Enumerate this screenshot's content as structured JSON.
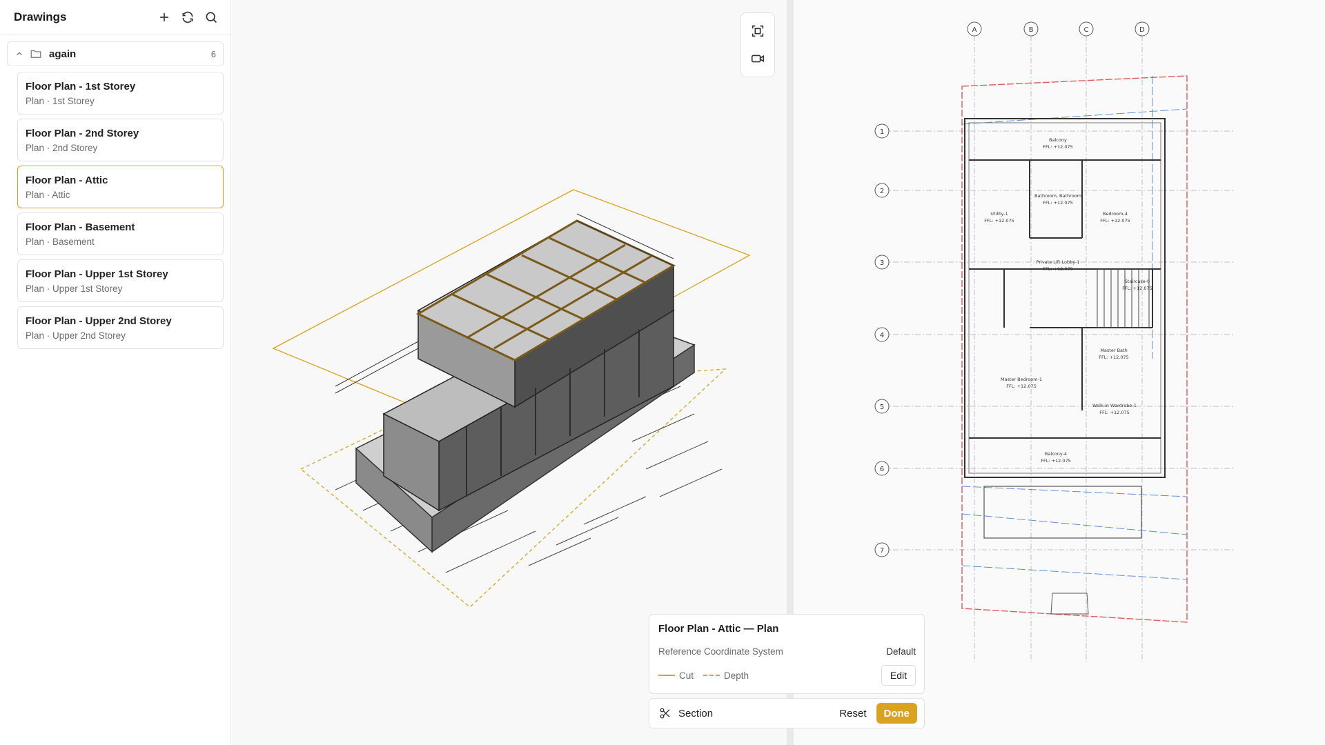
{
  "sidebar": {
    "title": "Drawings",
    "icons": [
      "plus-icon",
      "refresh-icon",
      "search-icon"
    ],
    "folder": {
      "name": "again",
      "count": "6"
    },
    "items": [
      {
        "title": "Floor Plan - 1st Storey",
        "subtitle": "Plan · 1st Storey",
        "selected": false
      },
      {
        "title": "Floor Plan - 2nd Storey",
        "subtitle": "Plan · 2nd Storey",
        "selected": false
      },
      {
        "title": "Floor Plan - Attic",
        "subtitle": "Plan · Attic",
        "selected": true
      },
      {
        "title": "Floor Plan - Basement",
        "subtitle": "Plan · Basement",
        "selected": false
      },
      {
        "title": "Floor Plan - Upper 1st Storey",
        "subtitle": "Plan · Upper 1st Storey",
        "selected": false
      },
      {
        "title": "Floor Plan - Upper 2nd Storey",
        "subtitle": "Plan · Upper 2nd Storey",
        "selected": false
      }
    ]
  },
  "view_controls": [
    "frame-icon",
    "camera-icon"
  ],
  "plan": {
    "grid_columns": [
      "A",
      "B",
      "C",
      "D"
    ],
    "grid_rows": [
      "1",
      "2",
      "3",
      "4",
      "5",
      "6",
      "7"
    ],
    "rooms": [
      {
        "name": "Balcony",
        "level": "FFL: +12.075"
      },
      {
        "name": "Bathroom, Bathroom",
        "level": "FFL: +12.075"
      },
      {
        "name": "Utility-1",
        "level": "FFL: +12.075"
      },
      {
        "name": "Bedroom-4",
        "level": "FFL: +12.075"
      },
      {
        "name": "Private Lift Lobby-1",
        "level": "FFL: +12.075"
      },
      {
        "name": "Staircase-0",
        "level": "FFL: +12.075"
      },
      {
        "name": "Master Bath",
        "level": "FFL: +12.075"
      },
      {
        "name": "Master Bedroom-1",
        "level": "FFL: +12.075"
      },
      {
        "name": "Walk-in Wardrobe-1",
        "level": "FFL: +12.075"
      },
      {
        "name": "Balcony-4",
        "level": "FFL: +12.075"
      }
    ]
  },
  "info": {
    "title": "Floor Plan - Attic — Plan",
    "ref_label": "Reference Coordinate System",
    "ref_value": "Default",
    "legend_cut": "Cut",
    "legend_depth": "Depth",
    "edit_label": "Edit"
  },
  "section": {
    "label": "Section",
    "reset_label": "Reset",
    "done_label": "Done"
  },
  "colors": {
    "accent": "#d9a220",
    "red_boundary": "#e05a5a",
    "blue_line": "#5c8fd6"
  }
}
